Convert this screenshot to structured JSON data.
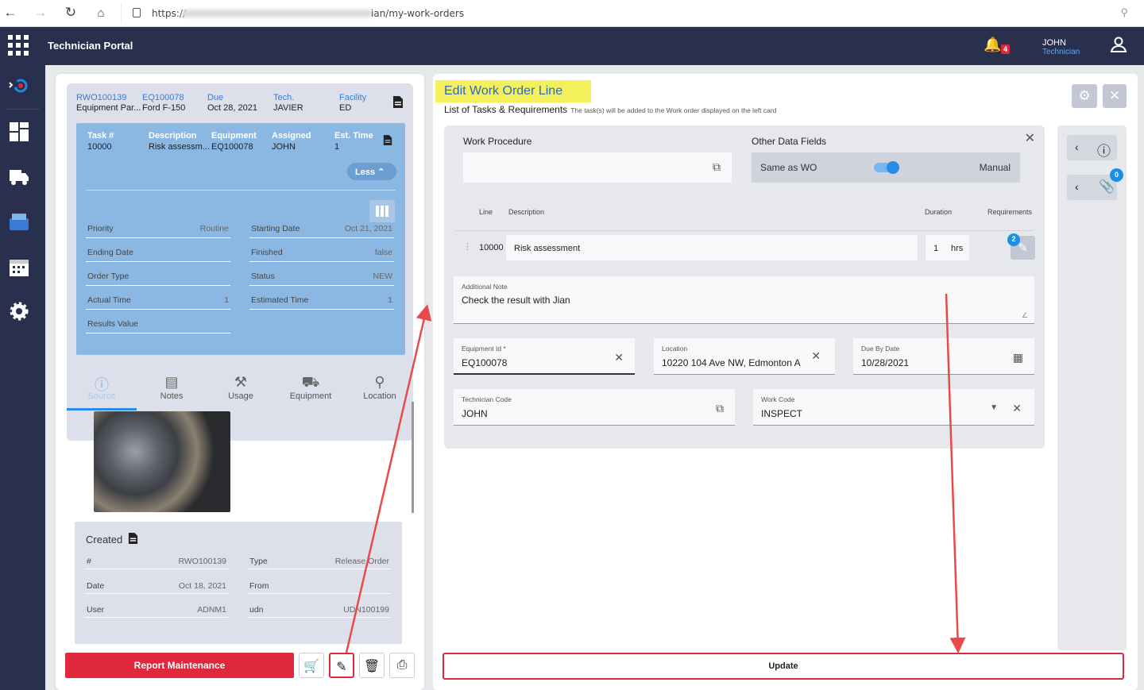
{
  "browser": {
    "url_prefix": "https://",
    "url_suffix": "ian/my-work-orders"
  },
  "app": {
    "title": "Technician Portal",
    "notifications": "4",
    "user_name": "JOHN",
    "user_role": "Technician"
  },
  "workorder": {
    "header": [
      {
        "label": "RWO100139",
        "value": "Equipment Par..."
      },
      {
        "label": "EQ100078",
        "value": "Ford F-150"
      },
      {
        "label": "Due",
        "value": "Oct 28, 2021"
      },
      {
        "label": "Tech.",
        "value": "JAVIER"
      },
      {
        "label": "Facility",
        "value": "ED"
      }
    ],
    "task_headers": [
      "Task #",
      "Description",
      "Equipment",
      "Assigned",
      "Est. Time"
    ],
    "task_values": [
      "10000",
      "Risk assessm...",
      "EQ100078",
      "JOHN",
      "1"
    ],
    "less_label": "Less",
    "fields_left": [
      {
        "label": "Priority",
        "value": "Routine"
      },
      {
        "label": "Ending Date",
        "value": ""
      },
      {
        "label": "Order Type",
        "value": ""
      },
      {
        "label": "Actual Time",
        "value": "1"
      },
      {
        "label": "Results Value",
        "value": ""
      }
    ],
    "fields_right": [
      {
        "label": "Starting Date",
        "value": "Oct 21, 2021"
      },
      {
        "label": "Finished",
        "value": "false"
      },
      {
        "label": "Status",
        "value": "NEW"
      },
      {
        "label": "Estimated Time",
        "value": "1"
      }
    ],
    "tabs": [
      "Source",
      "Notes",
      "Usage",
      "Equipment",
      "Location"
    ],
    "created": {
      "title": "Created",
      "left": [
        {
          "label": "#",
          "value": "RWO100139"
        },
        {
          "label": "Date",
          "value": "Oct 18, 2021"
        },
        {
          "label": "User",
          "value": "ADNM1"
        }
      ],
      "right": [
        {
          "label": "Type",
          "value": "Release Order"
        },
        {
          "label": "From",
          "value": ""
        },
        {
          "label": "udn",
          "value": "UDN100199"
        }
      ]
    },
    "report_label": "Report Maintenance"
  },
  "edit": {
    "title": "Edit Work Order Line",
    "subtitle": "List of Tasks & Requirements",
    "subtitle_note": "The task(s) will be added to the Work order displayed on the left card",
    "work_procedure_label": "Work Procedure",
    "other_fields_label": "Other Data Fields",
    "same_as_wo": "Same as WO",
    "manual": "Manual",
    "columns": {
      "line": "Line",
      "description": "Description",
      "duration": "Duration",
      "requirements": "Requirements"
    },
    "line": {
      "num": "10000",
      "description": "Risk assessment",
      "duration": "1",
      "unit": "hrs",
      "req_count": "2"
    },
    "note": {
      "label": "Additional Note",
      "value": "Check the result with Jian"
    },
    "equipment": {
      "label": "Equipment Id *",
      "value": "EQ100078"
    },
    "location": {
      "label": "Location",
      "value": "10220 104 Ave NW, Edmonton A"
    },
    "due": {
      "label": "Due By Date",
      "value": "10/28/2021"
    },
    "tech": {
      "label": "Technician Code",
      "value": "JOHN"
    },
    "workcode": {
      "label": "Work Code",
      "value": "INSPECT"
    },
    "attach_count": "0",
    "update_label": "Update"
  }
}
